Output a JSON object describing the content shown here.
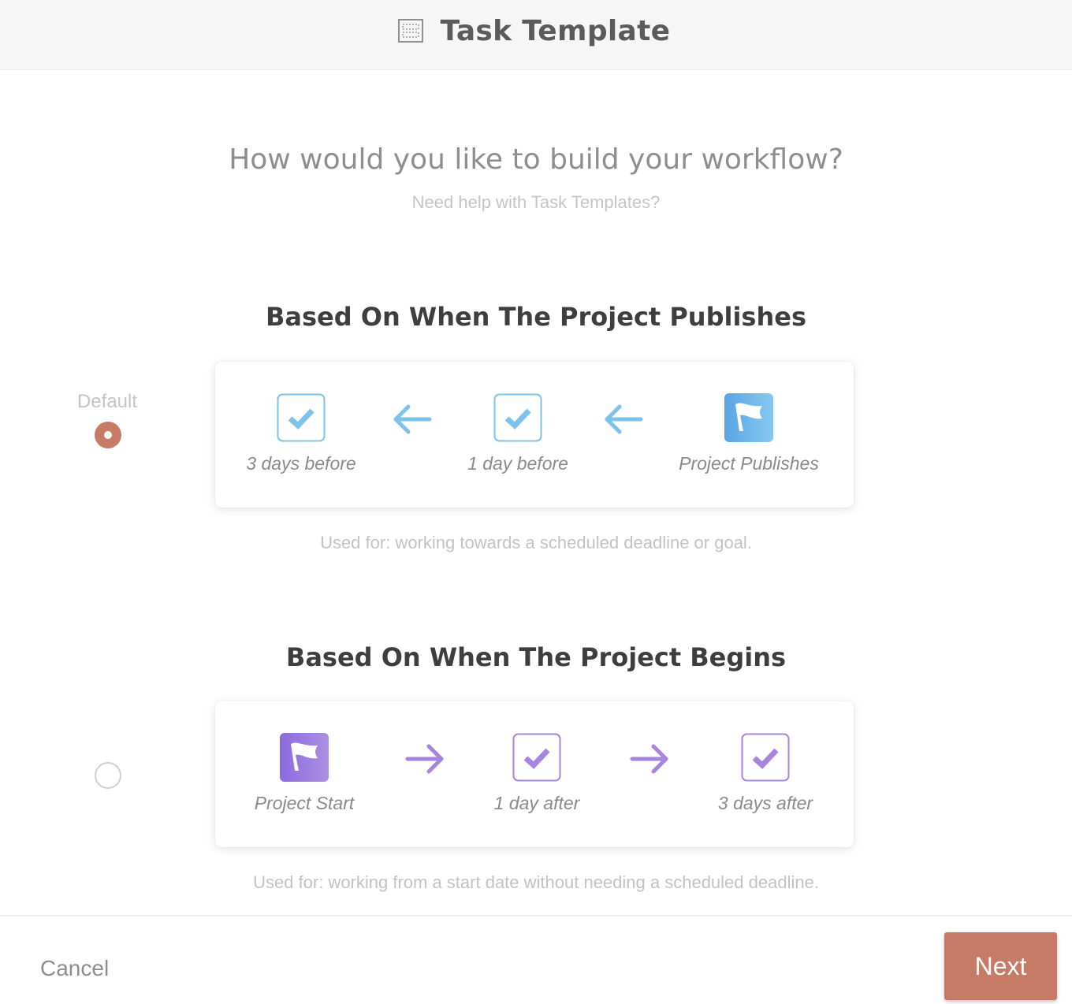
{
  "header": {
    "title": "Task Template",
    "icon": "template-grid-icon"
  },
  "intro": {
    "question": "How would you like to build your workflow?",
    "help_link": "Need help with Task Templates?"
  },
  "options": [
    {
      "title": "Based On When The Project Publishes",
      "default_label": "Default",
      "selected": true,
      "accent": "#7cc3ec",
      "steps": [
        {
          "label": "3 days before",
          "icon": "checkbox-icon"
        },
        {
          "label": "1 day before",
          "icon": "checkbox-icon"
        },
        {
          "label": "Project Publishes",
          "icon": "flag-icon"
        }
      ],
      "arrow_direction": "left",
      "used_for": "Used for: working towards a scheduled deadline or goal."
    },
    {
      "title": "Based On When The Project Begins",
      "selected": false,
      "accent": "#a784de",
      "steps": [
        {
          "label": "Project Start",
          "icon": "flag-icon"
        },
        {
          "label": "1 day after",
          "icon": "checkbox-icon"
        },
        {
          "label": "3 days after",
          "icon": "checkbox-icon"
        }
      ],
      "arrow_direction": "right",
      "used_for": "Used for: working from a start date without needing a scheduled deadline."
    }
  ],
  "footer": {
    "cancel_label": "Cancel",
    "next_label": "Next",
    "accent": "#c77b66"
  }
}
